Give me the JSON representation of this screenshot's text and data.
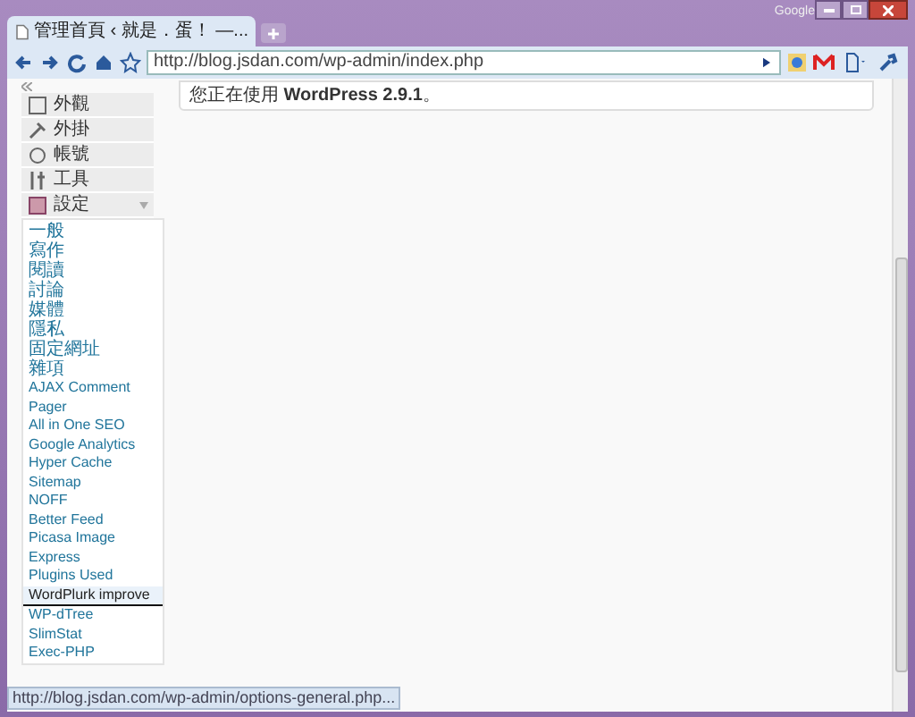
{
  "window": {
    "brand": "Google"
  },
  "tabs": [
    {
      "label": "管理首頁 ‹ 就是．蛋！ —...",
      "selected": true
    }
  ],
  "address_bar": {
    "value": "http://blog.jsdan.com/wp-admin/index.php"
  },
  "notice": "您正在使用 **WordPress 2.9.1**。",
  "menu": [
    {
      "label": "外觀",
      "expanded": false
    },
    {
      "label": "外掛",
      "expanded": false
    },
    {
      "label": "帳號",
      "expanded": false
    },
    {
      "label": "工具",
      "expanded": false
    },
    {
      "label": "設定",
      "expanded": true
    }
  ],
  "submenu": [
    {
      "label": "一般",
      "kind": "core",
      "selected": false
    },
    {
      "label": "寫作",
      "kind": "core",
      "selected": false
    },
    {
      "label": "閱讀",
      "kind": "core",
      "selected": false
    },
    {
      "label": "討論",
      "kind": "core",
      "selected": false
    },
    {
      "label": "媒體",
      "kind": "core",
      "selected": false
    },
    {
      "label": "隱私",
      "kind": "core",
      "selected": false
    },
    {
      "label": "固定網址",
      "kind": "core",
      "selected": false
    },
    {
      "label": "雜項",
      "kind": "core",
      "selected": false
    },
    {
      "label": "AJAX Comment Pager",
      "kind": "plugin",
      "selected": false
    },
    {
      "label": "All in One SEO",
      "kind": "plugin",
      "selected": false
    },
    {
      "label": "Google Analytics",
      "kind": "plugin",
      "selected": false
    },
    {
      "label": "Hyper Cache",
      "kind": "plugin",
      "selected": false
    },
    {
      "label": "Sitemap",
      "kind": "plugin",
      "selected": false
    },
    {
      "label": "NOFF",
      "kind": "plugin",
      "selected": false
    },
    {
      "label": "Better Feed",
      "kind": "plugin",
      "selected": false
    },
    {
      "label": "Picasa Image Express",
      "kind": "plugin",
      "selected": false
    },
    {
      "label": "Plugins Used",
      "kind": "plugin",
      "selected": false
    },
    {
      "label": "WordPlurk improve",
      "kind": "plugin",
      "selected": true
    },
    {
      "label": "WP-dTree",
      "kind": "plugin",
      "selected": false
    },
    {
      "label": "SlimStat",
      "kind": "plugin",
      "selected": false
    },
    {
      "label": "Exec-PHP",
      "kind": "plugin",
      "selected": false
    }
  ],
  "status_bar": "http://blog.jsdan.com/wp-admin/options-general.php..."
}
